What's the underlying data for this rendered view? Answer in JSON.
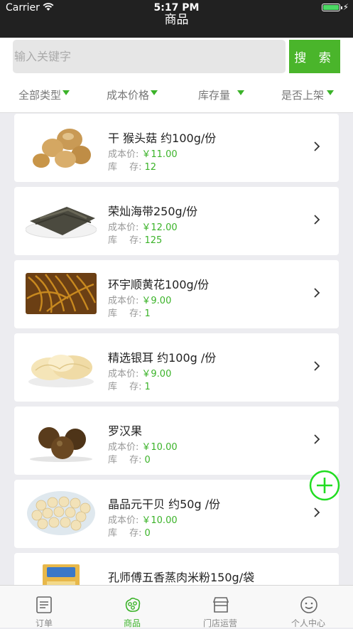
{
  "status": {
    "carrier": "Carrier",
    "time": "5:17 PM"
  },
  "nav": {
    "title": "商品"
  },
  "search": {
    "placeholder": "输入关键字",
    "button": "搜 索"
  },
  "filters": [
    {
      "label": "全部类型"
    },
    {
      "label": "成本价格"
    },
    {
      "label": "库存量"
    },
    {
      "label": "是否上架"
    }
  ],
  "cost_label": "成本价:",
  "stock_label": "库　 存:",
  "products": [
    {
      "name": "干 猴头菇 约100g/份",
      "price": "￥11.00",
      "stock": "12",
      "image": "mushroom"
    },
    {
      "name": "荣灿海带250g/份",
      "price": "￥12.00",
      "stock": "125",
      "image": "kelp"
    },
    {
      "name": "环宇顺黄花100g/份",
      "price": "￥9.00",
      "stock": "1",
      "image": "daylily"
    },
    {
      "name": "精选银耳 约100g /份",
      "price": "￥9.00",
      "stock": "1",
      "image": "white-fungus"
    },
    {
      "name": "罗汉果",
      "price": "￥10.00",
      "stock": "0",
      "image": "monk-fruit"
    },
    {
      "name": "晶品元干贝 约50g /份",
      "price": "￥10.00",
      "stock": "0",
      "image": "scallop"
    },
    {
      "name": "孔师傅五香蒸肉米粉150g/袋",
      "price": "",
      "stock": "",
      "image": "rice-powder"
    }
  ],
  "tabs": [
    {
      "label": "订单",
      "icon": "order-icon"
    },
    {
      "label": "商品",
      "icon": "goods-icon"
    },
    {
      "label": "门店运营",
      "icon": "store-icon"
    },
    {
      "label": "个人中心",
      "icon": "profile-icon"
    }
  ],
  "colors": {
    "accent": "#3bb329",
    "button": "#4ab52b",
    "header": "#212121"
  }
}
